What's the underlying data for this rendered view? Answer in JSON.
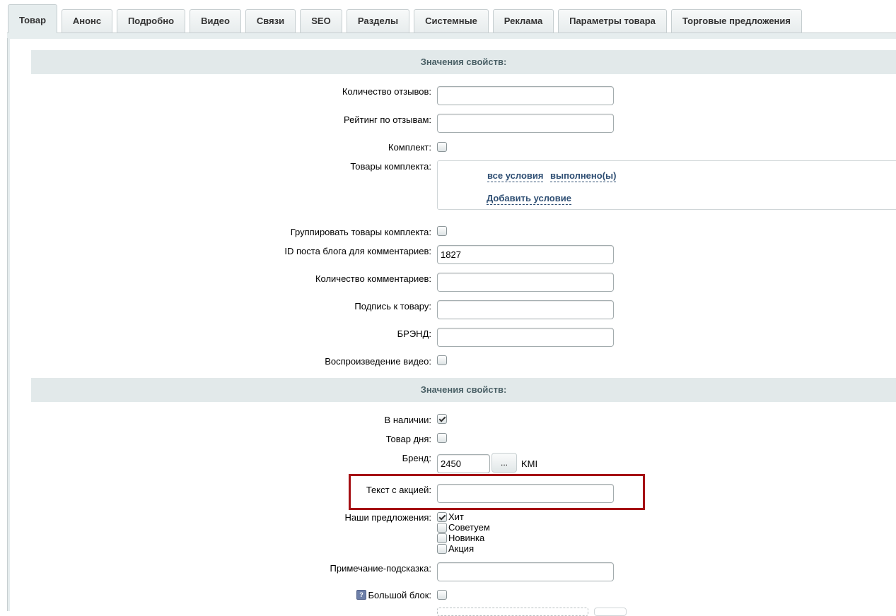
{
  "tabs": [
    {
      "label": "Товар",
      "active": true
    },
    {
      "label": "Анонс"
    },
    {
      "label": "Подробно"
    },
    {
      "label": "Видео"
    },
    {
      "label": "Связи"
    },
    {
      "label": "SEO"
    },
    {
      "label": "Разделы"
    },
    {
      "label": "Системные"
    },
    {
      "label": "Реклама"
    },
    {
      "label": "Параметры товара"
    },
    {
      "label": "Торговые предложения"
    }
  ],
  "section1": {
    "title": "Значения свойств:",
    "fields": {
      "reviews_count": {
        "label": "Количество отзывов:",
        "value": ""
      },
      "reviews_rating": {
        "label": "Рейтинг по отзывам:",
        "value": ""
      },
      "kit": {
        "label": "Комплект:",
        "checked": false
      },
      "kit_products": {
        "label": "Товары комплекта:",
        "link_all": "все условия",
        "link_done": "выполнено(ы)",
        "link_add": "Добавить условие"
      },
      "group_kit": {
        "label": "Группировать товары комплекта:",
        "checked": false
      },
      "blog_post_id": {
        "label": "ID поста блога для комментариев:",
        "value": "1827"
      },
      "comments_count": {
        "label": "Количество комментариев:",
        "value": ""
      },
      "caption": {
        "label": "Подпись к товару:",
        "value": ""
      },
      "brand_text": {
        "label": "БРЭНД:",
        "value": ""
      },
      "video_play": {
        "label": "Воспроизведение видео:",
        "checked": false
      }
    }
  },
  "section2": {
    "title": "Значения свойств:",
    "fields": {
      "in_stock": {
        "label": "В наличии:",
        "checked": true
      },
      "product_of_day": {
        "label": "Товар дня:",
        "checked": false
      },
      "brand": {
        "label": "Бренд:",
        "value": "2450",
        "button": "...",
        "name": "KMI"
      },
      "promo_text": {
        "label": "Текст с акцией:",
        "value": ""
      },
      "offers": {
        "label": "Наши предложения:",
        "options": [
          {
            "label": "Хит",
            "checked": true
          },
          {
            "label": "Советуем",
            "checked": false
          },
          {
            "label": "Новинка",
            "checked": false
          },
          {
            "label": "Акция",
            "checked": false
          }
        ]
      },
      "hint_note": {
        "label": "Примечание-подсказка:",
        "value": ""
      },
      "big_block": {
        "label": "Большой блок:",
        "help_icon": "?",
        "checked": false
      }
    }
  },
  "colors": {
    "highlight": "#a50f14",
    "link": "#2e4e73",
    "section_bg": "#e2e9ea"
  }
}
